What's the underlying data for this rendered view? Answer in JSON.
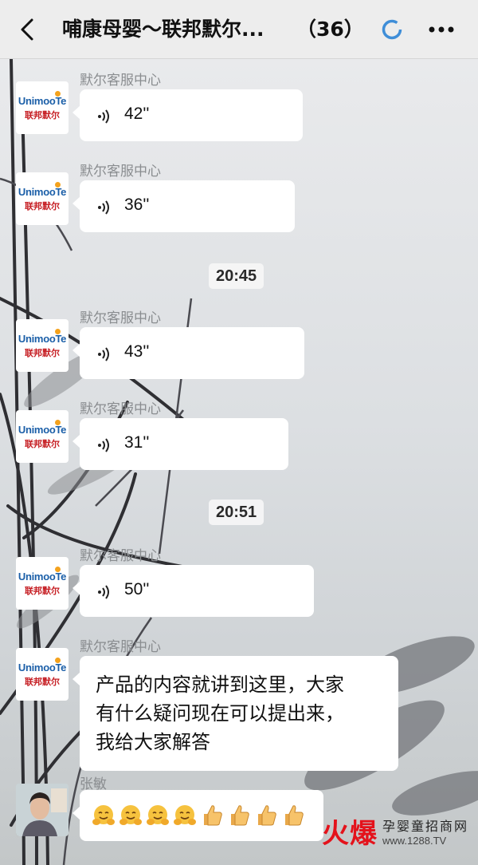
{
  "header": {
    "title": "哺康母婴～联邦默尔...",
    "member_count": "（36）"
  },
  "avatar_logo": {
    "brand_latin": "Unimoo",
    "brand_latin_tail": "Te",
    "brand_cn": "联邦默尔"
  },
  "messages": [
    {
      "sender": "默尔客服中心",
      "type": "voice",
      "duration": "42''"
    },
    {
      "sender": "默尔客服中心",
      "type": "voice",
      "duration": "36''"
    },
    {
      "type": "time",
      "text": "20:45"
    },
    {
      "sender": "默尔客服中心",
      "type": "voice",
      "duration": "43''"
    },
    {
      "sender": "默尔客服中心",
      "type": "voice",
      "duration": "31''"
    },
    {
      "type": "time",
      "text": "20:51"
    },
    {
      "sender": "默尔客服中心",
      "type": "voice",
      "duration": "50''"
    },
    {
      "sender": "默尔客服中心",
      "type": "text",
      "lines": [
        "产品的内容就讲到这里，大家",
        "有什么疑问现在可以提出来，",
        "我给大家解答"
      ]
    },
    {
      "sender": "张敏",
      "type": "emoji",
      "emojis": [
        "hug-face",
        "hug-face",
        "hug-face",
        "hug-face",
        "thumbs-up",
        "thumbs-up",
        "thumbs-up",
        "thumbs-up"
      ]
    }
  ],
  "watermark": {
    "main": "火爆",
    "top": "孕婴童招商网",
    "url": "www.1288.TV"
  },
  "colors": {
    "navbar_bg": "#ededed",
    "bubble_bg": "#ffffff",
    "sender_text": "#8a8d90",
    "brand_blue": "#1b5fa8",
    "brand_red": "#c61f24",
    "watermark_red": "#e4121b"
  }
}
